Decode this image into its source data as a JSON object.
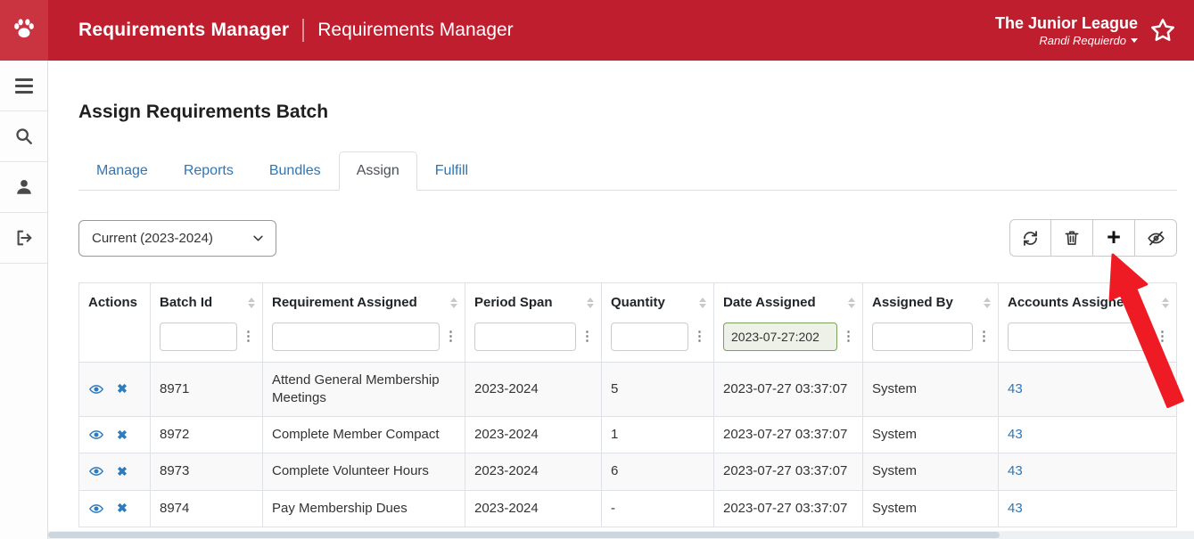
{
  "colors": {
    "header_red": "#bf1e2e",
    "logo_red": "#ca3340",
    "link_blue": "#2e76b5",
    "arrow_red": "#ee1b24",
    "filter_highlight_bg": "#edf1e7",
    "filter_highlight_border": "#7aa05a"
  },
  "topbar": {
    "app_title": "Requirements Manager",
    "context_title": "Requirements Manager",
    "org_name": "The Junior League",
    "user_name": "Randi Requierdo"
  },
  "sidebar": {
    "items": [
      {
        "name": "menu"
      },
      {
        "name": "search"
      },
      {
        "name": "profile"
      },
      {
        "name": "logout"
      }
    ]
  },
  "page": {
    "title": "Assign Requirements Batch"
  },
  "tabs": [
    {
      "label": "Manage",
      "active": false
    },
    {
      "label": "Reports",
      "active": false
    },
    {
      "label": "Bundles",
      "active": false
    },
    {
      "label": "Assign",
      "active": true
    },
    {
      "label": "Fulfill",
      "active": false
    }
  ],
  "controls": {
    "period_select_value": "Current (2023-2024)"
  },
  "toolbar": {
    "buttons": [
      {
        "name": "refresh"
      },
      {
        "name": "delete"
      },
      {
        "name": "add"
      },
      {
        "name": "toggle-visibility"
      }
    ]
  },
  "table": {
    "columns": [
      {
        "label": "Actions",
        "sortable": false,
        "filterable": false
      },
      {
        "label": "Batch Id",
        "filter_value": "",
        "sortable": true
      },
      {
        "label": "Requirement Assigned",
        "filter_value": "",
        "sortable": true
      },
      {
        "label": "Period Span",
        "filter_value": "",
        "sortable": true
      },
      {
        "label": "Quantity",
        "filter_value": "",
        "sortable": true
      },
      {
        "label": "Date Assigned",
        "filter_value": "2023-07-27:202",
        "filter_highlighted": true,
        "sortable": true
      },
      {
        "label": "Assigned By",
        "filter_value": "",
        "sortable": true
      },
      {
        "label": "Accounts Assigned",
        "filter_value": "",
        "sortable": true
      }
    ],
    "rows": [
      {
        "batch_id": "8971",
        "requirement": "Attend General Membership Meetings",
        "period_span": "2023-2024",
        "quantity": "5",
        "date_assigned": "2023-07-27 03:37:07",
        "assigned_by": "System",
        "accounts_assigned": "43"
      },
      {
        "batch_id": "8972",
        "requirement": "Complete Member Compact",
        "period_span": "2023-2024",
        "quantity": "1",
        "date_assigned": "2023-07-27 03:37:07",
        "assigned_by": "System",
        "accounts_assigned": "43"
      },
      {
        "batch_id": "8973",
        "requirement": "Complete Volunteer Hours",
        "period_span": "2023-2024",
        "quantity": "6",
        "date_assigned": "2023-07-27 03:37:07",
        "assigned_by": "System",
        "accounts_assigned": "43"
      },
      {
        "batch_id": "8974",
        "requirement": "Pay Membership Dues",
        "period_span": "2023-2024",
        "quantity": "-",
        "date_assigned": "2023-07-27 03:37:07",
        "assigned_by": "System",
        "accounts_assigned": "43"
      }
    ]
  },
  "icons": {
    "kebab": "⋮",
    "close": "✖",
    "plus": "+"
  }
}
